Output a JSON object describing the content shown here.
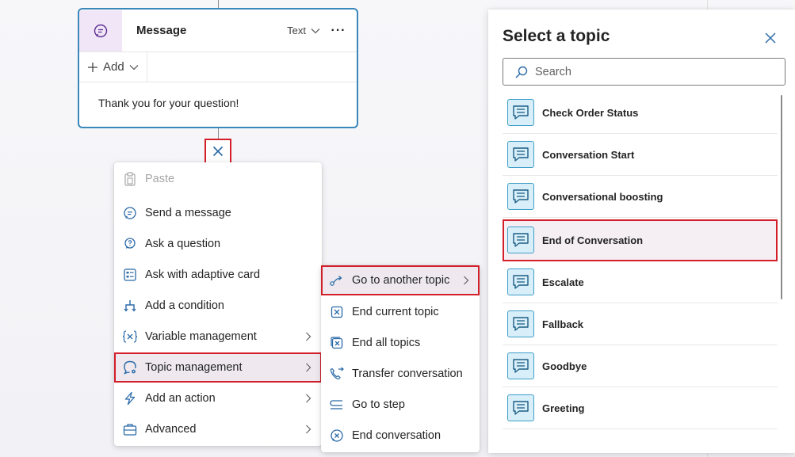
{
  "message_node": {
    "title": "Message",
    "type_label": "Text",
    "more_label": "···",
    "add_label": "Add",
    "body_text": "Thank you for your question!"
  },
  "context_menu": {
    "items": [
      {
        "label": "Paste",
        "icon": "paste-icon",
        "disabled": true
      },
      {
        "label": "Send a message",
        "icon": "chat-bubble-icon"
      },
      {
        "label": "Ask a question",
        "icon": "question-icon"
      },
      {
        "label": "Ask with adaptive card",
        "icon": "adaptive-card-icon"
      },
      {
        "label": "Add a condition",
        "icon": "branch-icon"
      },
      {
        "label": "Variable management",
        "icon": "variable-icon",
        "submenu": true
      },
      {
        "label": "Topic management",
        "icon": "topic-management-icon",
        "submenu": true,
        "highlighted": true
      },
      {
        "label": "Add an action",
        "icon": "lightning-icon",
        "submenu": true
      },
      {
        "label": "Advanced",
        "icon": "toolbox-icon",
        "submenu": true
      }
    ]
  },
  "topic_submenu": {
    "items": [
      {
        "label": "Go to another topic",
        "icon": "redirect-icon",
        "submenu": true,
        "highlighted": true
      },
      {
        "label": "End current topic",
        "icon": "end-topic-icon"
      },
      {
        "label": "End all topics",
        "icon": "end-all-icon"
      },
      {
        "label": "Transfer conversation",
        "icon": "transfer-icon"
      },
      {
        "label": "Go to step",
        "icon": "goto-step-icon"
      },
      {
        "label": "End conversation",
        "icon": "end-conversation-icon"
      }
    ]
  },
  "topic_panel": {
    "title": "Select a topic",
    "search_placeholder": "Search",
    "topics": [
      {
        "label": "Check Order Status"
      },
      {
        "label": "Conversation Start"
      },
      {
        "label": "Conversational boosting"
      },
      {
        "label": "End of Conversation",
        "highlighted": true
      },
      {
        "label": "Escalate"
      },
      {
        "label": "Fallback"
      },
      {
        "label": "Goodbye"
      },
      {
        "label": "Greeting"
      }
    ]
  },
  "colors": {
    "accent": "#3a87b9",
    "highlight_border": "#d21f2a",
    "topic_icon_bg": "#d8eef8",
    "message_icon_bg": "#f1e6f7"
  }
}
